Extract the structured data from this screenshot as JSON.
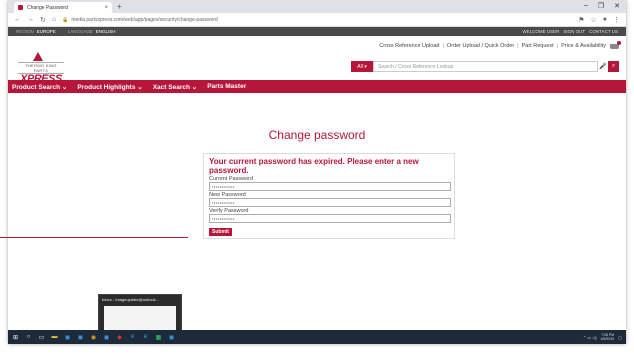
{
  "browser": {
    "tab_title": "Change Password",
    "url": "media.partsxpress.com/web/app/pages/security/change-password",
    "new_tab": "+",
    "tab_close": "×"
  },
  "topbar": {
    "region_label": "REGION",
    "region_value": "EUROPE",
    "language_label": "LANGUAGE",
    "language_value": "ENGLISH",
    "user": "WELCOME USER",
    "sign_out": "SIGN OUT",
    "contact": "CONTACT US"
  },
  "logo": {
    "brand": "THERMO KING PARTS",
    "name": "XPRESS"
  },
  "header_links": [
    "Cross Reference Upload",
    "Order Upload / Quick Order",
    "Part Request",
    "Price & Availability"
  ],
  "search": {
    "category": "All",
    "placeholder": "Search / Cross Reference Lookup"
  },
  "nav": [
    "Product Search",
    "Product Highlights",
    "Xact Search",
    "Parts Master"
  ],
  "form": {
    "title": "Change password",
    "message": "Your current password has expired. Please enter a new password.",
    "current_label": "Current Password",
    "current_value": "••••••••••••",
    "new_label": "New Password",
    "new_value": "••••••••••••",
    "verify_label": "Verify Password",
    "verify_value": "••••••••••••",
    "submit_label": "Submit"
  },
  "taskbar": {
    "preview_title": "Inbox - Imageupdate@outlook...",
    "time": "7:08 PM",
    "date": "4/5/2019"
  },
  "colors": {
    "accent": "#b5163a",
    "topbar": "#4a4a4a",
    "taskbar": "#1c2a3a"
  }
}
